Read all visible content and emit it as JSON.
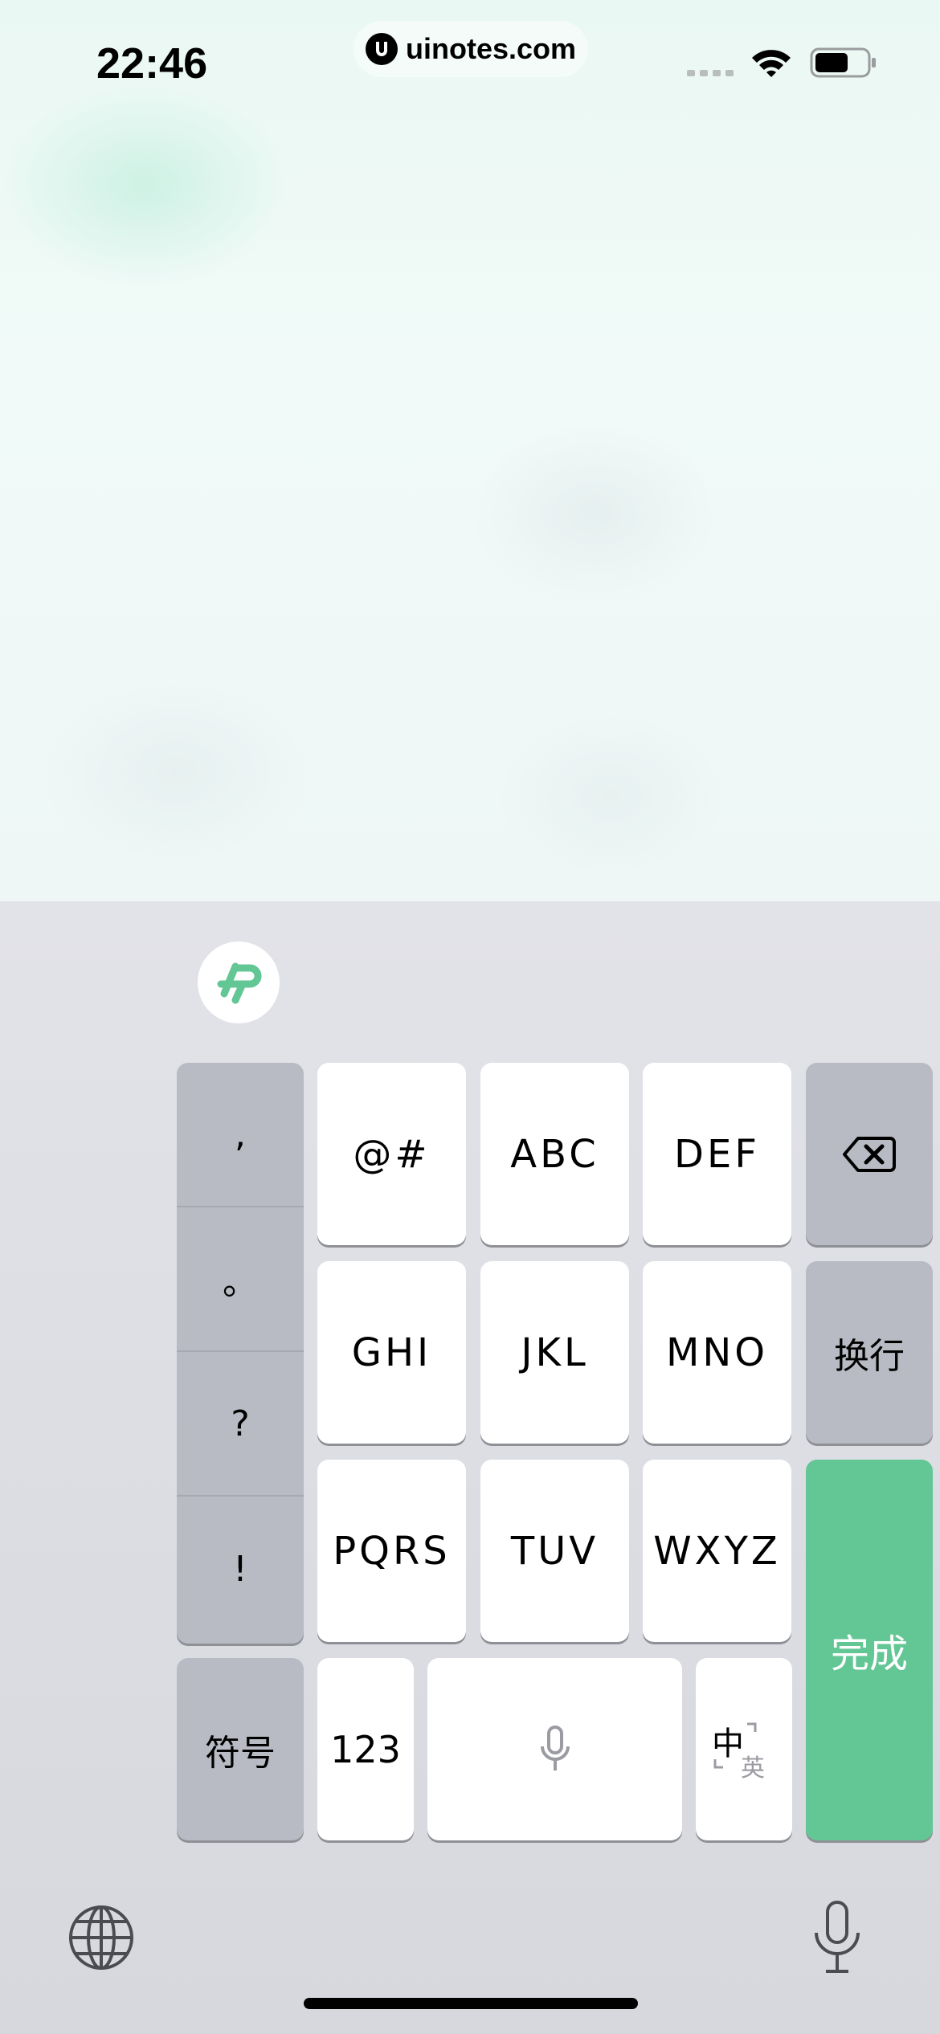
{
  "status_bar": {
    "time": "22:46",
    "url": "uinotes.com",
    "icons": [
      "cellular-signal-icon",
      "wifi-icon",
      "battery-icon"
    ]
  },
  "keyboard": {
    "suggestion_icon": "pinyin-logo-icon",
    "punctuation": [
      ",",
      "。",
      "?",
      "!"
    ],
    "rows": [
      [
        "@#",
        "ABC",
        "DEF"
      ],
      [
        "GHI",
        "JKL",
        "MNO"
      ],
      [
        "PQRS",
        "TUV",
        "WXYZ"
      ]
    ],
    "delete_icon": "backspace-icon",
    "return_label": "换行",
    "done_label": "完成",
    "symbols_label": "符号",
    "numbers_label": "123",
    "space_icon": "microphone-icon",
    "lang_switch": {
      "primary": "中",
      "secondary": "英"
    },
    "bottom": {
      "left_icon": "globe-icon",
      "right_icon": "dictation-icon"
    }
  },
  "colors": {
    "accent_green": "#63c695",
    "key_dark": "#b8bbc3",
    "key_light": "#ffffff"
  }
}
